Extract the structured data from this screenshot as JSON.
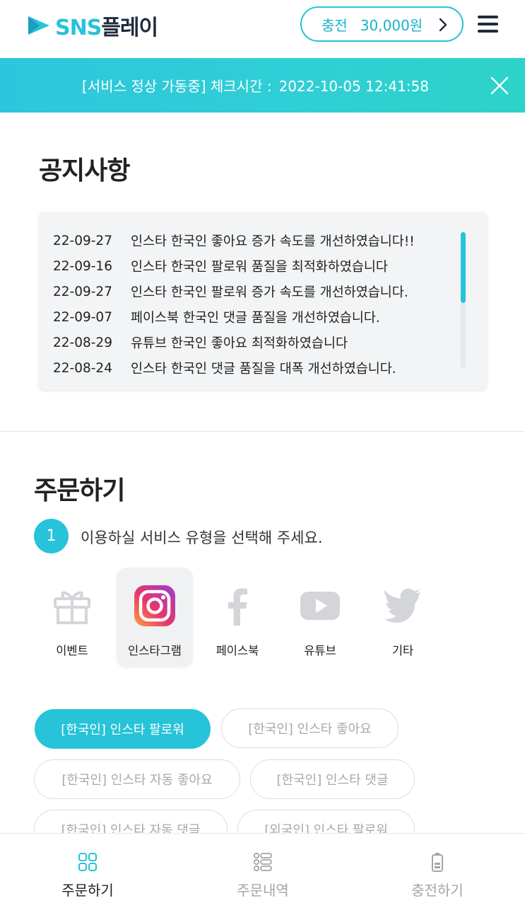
{
  "header": {
    "logo_prefix": "SNS",
    "logo_suffix": "플레이",
    "charge_label": "충전",
    "charge_amount": "30,000원"
  },
  "banner": {
    "status": "[서비스 정상 가동중] 체크시간 :",
    "time": "2022-10-05 12:41:58"
  },
  "notice": {
    "title": "공지사항",
    "items": [
      {
        "date": "22-09-27",
        "text": "인스타 한국인 좋아요 증가 속도를 개선하였습니다!!"
      },
      {
        "date": "22-09-16",
        "text": "인스타 한국인 팔로워 품질을 최적화하였습니다"
      },
      {
        "date": "22-09-27",
        "text": "인스타 한국인 팔로워 증가 속도를 개선하였습니다."
      },
      {
        "date": "22-09-07",
        "text": "페이스북 한국인 댓글 품질을 개선하였습니다."
      },
      {
        "date": "22-08-29",
        "text": "유튜브 한국인 좋아요 최적화하였습니다"
      },
      {
        "date": "22-08-24",
        "text": "인스타 한국인 댓글 품질을 대폭 개선하였습니다."
      }
    ]
  },
  "order": {
    "title": "주문하기",
    "step_number": "1",
    "step_text": "이용하실 서비스 유형을 선택해 주세요.",
    "services": [
      {
        "label": "이벤트",
        "icon": "gift-icon",
        "active": false
      },
      {
        "label": "인스타그램",
        "icon": "instagram-icon",
        "active": true
      },
      {
        "label": "페이스북",
        "icon": "facebook-icon",
        "active": false
      },
      {
        "label": "유튜브",
        "icon": "youtube-icon",
        "active": false
      },
      {
        "label": "기타",
        "icon": "twitter-icon",
        "active": false
      }
    ],
    "chips": [
      {
        "label": "[한국인] 인스타 팔로워",
        "active": true
      },
      {
        "label": "[한국인] 인스타 좋아요",
        "active": false
      },
      {
        "label": "[한국인] 인스타 자동 좋아요",
        "active": false
      },
      {
        "label": "[한국인] 인스타 댓글",
        "active": false
      },
      {
        "label": "[한국인] 인스타 자동 댓글",
        "active": false
      },
      {
        "label": "[외국인] 인스타 팔로워",
        "active": false
      }
    ]
  },
  "nav": {
    "items": [
      {
        "label": "주문하기",
        "icon": "grid-icon",
        "active": true
      },
      {
        "label": "주문내역",
        "icon": "list-icon",
        "active": false
      },
      {
        "label": "충전하기",
        "icon": "battery-icon",
        "active": false
      }
    ]
  },
  "colors": {
    "accent": "#26c3d9",
    "banner": "#2ec6dd",
    "dark": "#1f2a3a"
  }
}
